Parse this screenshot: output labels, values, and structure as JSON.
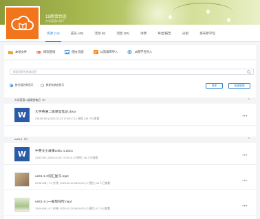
{
  "header": {
    "class_name": "19商贸合班",
    "class_subtitle": "大学英语口语下"
  },
  "tabs": [
    {
      "label": "资源 (14)",
      "active": true
    },
    {
      "label": "成员 (46)",
      "active": false
    },
    {
      "label": "活动 (8)",
      "active": false
    },
    {
      "label": "消息 (50)",
      "active": false
    },
    {
      "label": "详情",
      "active": false
    },
    {
      "label": "导出/报告",
      "active": false
    },
    {
      "label": "分组",
      "active": false
    },
    {
      "label": "发布新学包",
      "active": false
    }
  ],
  "toolbar": [
    {
      "label": "本地文件",
      "icon": "folder-icon",
      "color": "#f0a030"
    },
    {
      "label": "网页链接",
      "icon": "link-icon",
      "color": "#e8512f"
    },
    {
      "label": "图文页面",
      "icon": "image-text-icon",
      "color": "#2f85d0"
    },
    {
      "label": "从资源库导入",
      "icon": "import-resource-icon",
      "color": "#f28a1c"
    },
    {
      "label": "从教学包导入",
      "icon": "import-package-icon",
      "color": "#2f85d0"
    }
  ],
  "search": {
    "placeholder": "搜索资源名称或标签"
  },
  "view_options": [
    {
      "label": "按分组名称显示",
      "selected": true
    },
    {
      "label": "按发布状态显示",
      "selected": false
    }
  ],
  "buttons": {
    "sort": "排序",
    "batch": "批量管理"
  },
  "groups": [
    {
      "title": "大学英语二级课堂笔记（1）",
      "items": [
        {
          "name": "大学英语二级课堂笔记.docx",
          "meta": "238.85 KB  |  2020-02-23 17:59:17  |  2 经验  |  46 人已查看",
          "type": "word"
        }
      ]
    },
    {
      "title": "unit1-1（5）",
      "items": [
        {
          "name": "中英文小故事unit1-1.docx",
          "meta": "13.82 KB  |  2020-02-26 17:00:18  |  2 经验  |  38 人已查看",
          "type": "word"
        },
        {
          "name": "unit1-1-2词汇复习.mp4",
          "meta": "22.58 MB  |  7.4 分钟  |  2020-02-24 08:00:00  |  2 经验  |  46 人已查看",
          "type": "video"
        },
        {
          "name": "unit1-1-1一般现在时.mp4",
          "meta": "13.69 MB  |  9.7 分钟  |  2020-02-24 08:00:00  |  2 经验  |  47 人已查看",
          "type": "video2"
        }
      ]
    }
  ],
  "colors": {
    "accent": "#2f85d0",
    "logo_bg": "#f2741c"
  }
}
